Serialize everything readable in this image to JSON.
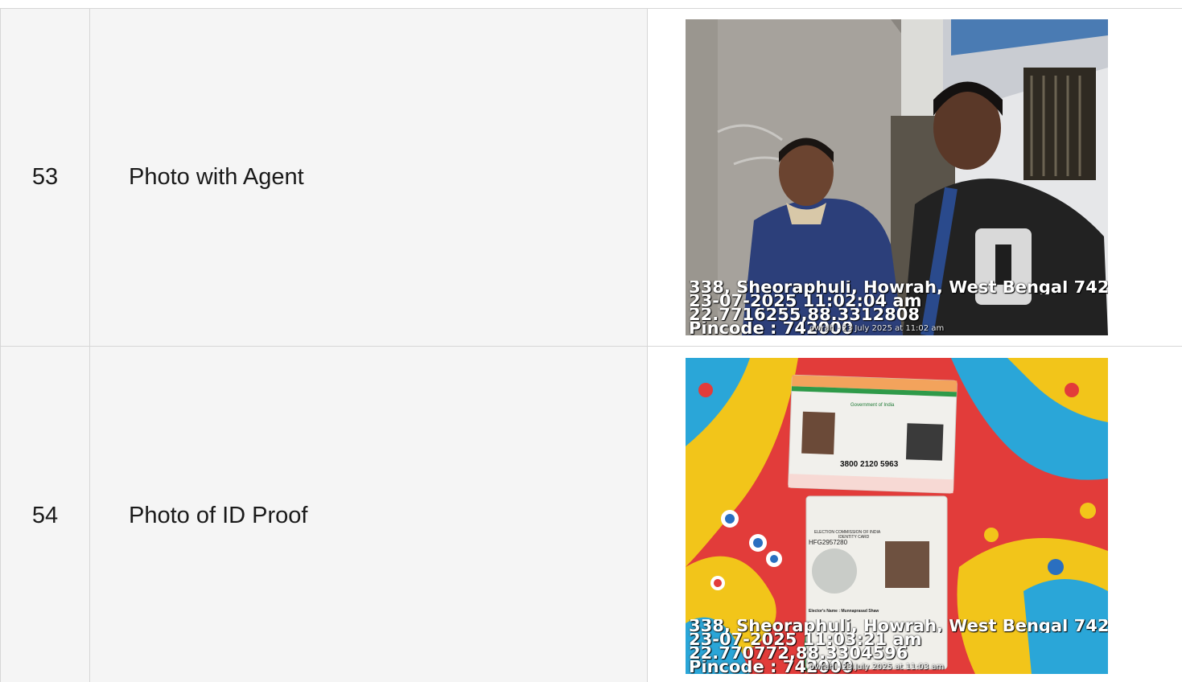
{
  "rows": [
    {
      "number": "53",
      "label": "Photo with Agent",
      "photo": {
        "address": "338, Sheoraphuli, Howrah, West Bengal 742",
        "datetime": "23-07-2025 11:02:04 am",
        "coords": "22.7716255,88.3312808",
        "pincode": "Pincode : 742000",
        "camera_stamp": "owrah · 23 July 2025 at 11:02 am"
      }
    },
    {
      "number": "54",
      "label": "Photo of ID Proof",
      "photo": {
        "address": "338, Sheoraphuli, Howrah, West Bengal 742",
        "datetime": "23-07-2025 11:03:21 am",
        "coords": "22.770772,88.3304596",
        "pincode": "Pincode : 742000",
        "camera_stamp": "owrah · 23 July 2025 at 11:03 am",
        "id_cards": {
          "aadhaar_number": "3800 2120 5963",
          "aadhaar_header": "Government of India",
          "voter_header": "ELECTION COMMISSION OF INDIA",
          "voter_subheader": "IDENTITY CARD",
          "voter_id": "HFG2957280",
          "elector_name": "Elector's Name : Munnaprasad Shaw"
        }
      }
    }
  ]
}
